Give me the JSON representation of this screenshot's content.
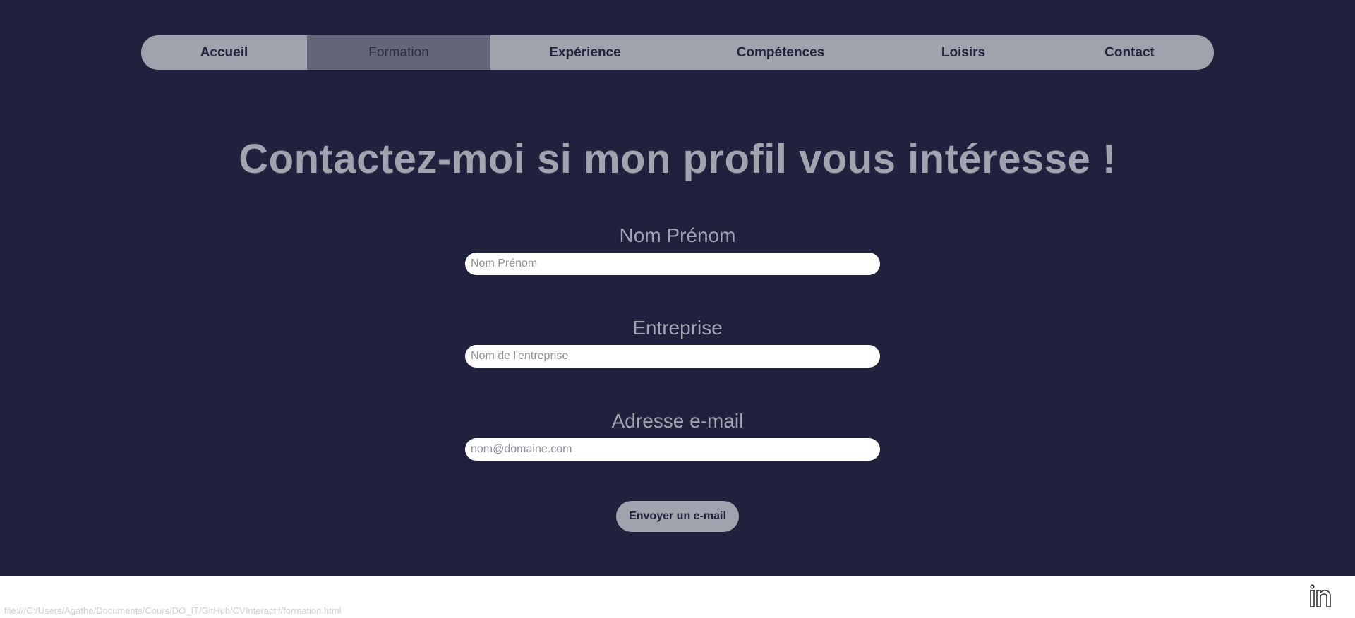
{
  "nav": {
    "items": [
      {
        "label": "Accueil"
      },
      {
        "label": "Formation"
      },
      {
        "label": "Expérience"
      },
      {
        "label": "Compétences"
      },
      {
        "label": "Loisirs"
      },
      {
        "label": "Contact"
      }
    ],
    "active_index": 1
  },
  "page": {
    "title": "Contactez-moi si mon profil vous intéresse !"
  },
  "form": {
    "name": {
      "label": "Nom Prénom",
      "placeholder": "Nom Prénom",
      "value": ""
    },
    "company": {
      "label": "Entreprise",
      "placeholder": "Nom de l'entreprise",
      "value": ""
    },
    "email": {
      "label": "Adresse e-mail",
      "placeholder": "nom@domaine.com",
      "value": ""
    },
    "submit_label": "Envoyer un e-mail"
  },
  "footer": {
    "status_url": "file:///C:/Users/Agathe/Documents/Cours/DO_IT/GitHub/CVInteractif/formation.html",
    "linkedin_icon": "linkedin-icon"
  },
  "colors": {
    "background": "#20213c",
    "nav": "#a0a2ae",
    "nav_active": "#636579",
    "text_muted": "#a2a3b0"
  }
}
